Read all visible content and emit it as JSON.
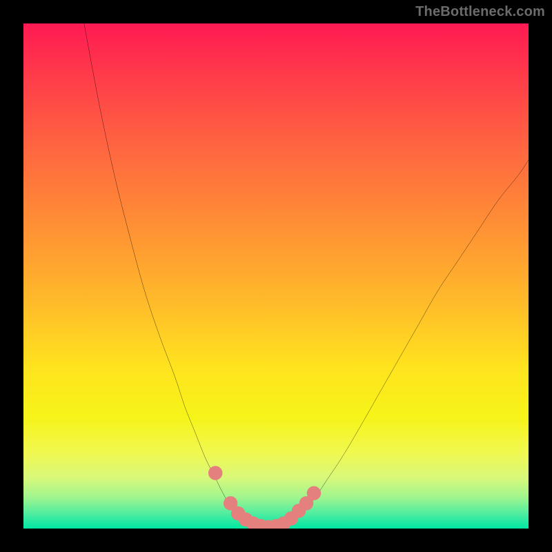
{
  "watermark": "TheBottleneck.com",
  "chart_data": {
    "type": "line",
    "title": "",
    "xlabel": "",
    "ylabel": "",
    "xlim": [
      0,
      100
    ],
    "ylim": [
      0,
      100
    ],
    "grid": false,
    "legend": false,
    "series": [
      {
        "name": "curve",
        "color": "#000000",
        "x": [
          12,
          15,
          18,
          21,
          24,
          27,
          30,
          32,
          34,
          36,
          38,
          39.5,
          41,
          42.5,
          44,
          46,
          48,
          50,
          52,
          54,
          56,
          58,
          60,
          63,
          66,
          70,
          74,
          78,
          82,
          86,
          90,
          94,
          98,
          100
        ],
        "y": [
          100,
          84,
          70,
          58,
          47,
          38,
          30,
          24,
          19,
          14,
          10,
          7,
          4.5,
          2.8,
          1.6,
          0.6,
          0.2,
          0.2,
          0.8,
          2,
          4,
          6.5,
          9.5,
          14,
          19,
          26,
          33,
          40,
          47,
          53,
          59,
          65,
          70,
          73
        ]
      },
      {
        "name": "markers",
        "type": "scatter",
        "color": "#e4817e",
        "x": [
          38,
          41,
          42.5,
          44,
          45.5,
          47,
          48.5,
          50,
          51.5,
          53,
          54.5,
          56,
          57.5
        ],
        "y": [
          11,
          5,
          3,
          1.8,
          1,
          0.5,
          0.3,
          0.5,
          1,
          2,
          3.5,
          5,
          7
        ]
      }
    ]
  }
}
